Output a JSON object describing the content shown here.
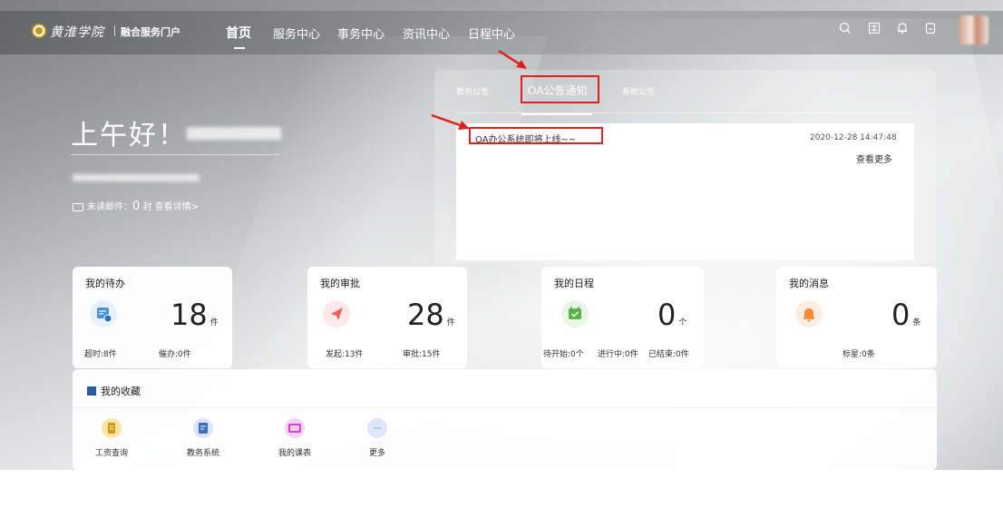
{
  "header": {
    "logo_text": "黄淮学院",
    "portal_name": "融合服务门户",
    "nav": [
      "首页",
      "服务中心",
      "事务中心",
      "资讯中心",
      "日程中心"
    ],
    "icons": [
      "search-icon",
      "scan-icon",
      "bell-icon",
      "clipboard-icon"
    ]
  },
  "greeting": {
    "text": "上午好！",
    "mail_label": "未读邮件：",
    "mail_count": "0",
    "mail_unit": "封",
    "mail_link": "查看详情>"
  },
  "notice": {
    "tabs": [
      "教务公告",
      "OA公告通知",
      "系统公告"
    ],
    "active_tab": 1,
    "item_title": "OA办公系统即将上线~~",
    "item_date": "2020-12-28 14:47:48",
    "more_label": "查看更多"
  },
  "cards": {
    "todo": {
      "title": "我的待办",
      "value": "18",
      "unit": "件",
      "stat1": "超时:8件",
      "stat2": "催办:0件"
    },
    "approval": {
      "title": "我的审批",
      "value": "28",
      "unit": "件",
      "stat1": "发起:13件",
      "stat2": "审批:15件"
    },
    "schedule": {
      "title": "我的日程",
      "value": "0",
      "unit": "个",
      "stat1": "待开始:0个",
      "stat2": "进行中:0件",
      "stat3": "已结束:0件"
    },
    "message": {
      "title": "我的消息",
      "value": "0",
      "unit": "条",
      "stat1": "标星:0条"
    }
  },
  "favorites": {
    "title": "我的收藏",
    "items": [
      "工资查询",
      "教务系统",
      "我的课表",
      "更多"
    ]
  },
  "colors": {
    "highlight": "#e02020",
    "todo_icon": "#4a90d9",
    "approval_icon": "#f25d5d",
    "schedule_icon": "#5bb34a",
    "message_icon": "#f58a3a"
  }
}
